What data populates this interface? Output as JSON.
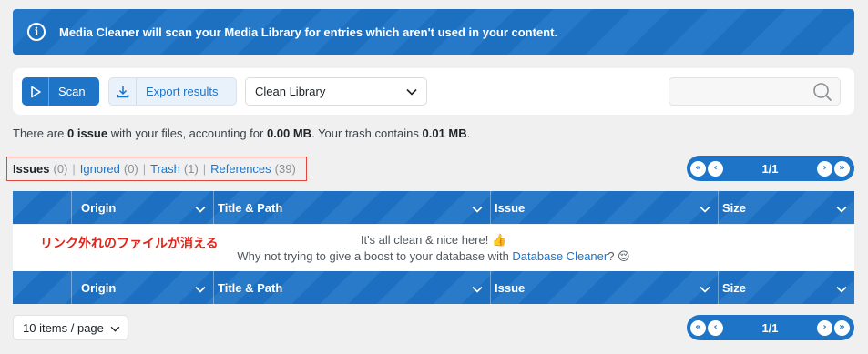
{
  "banner": {
    "icon": "info-icon",
    "text": "Media Cleaner will scan your Media Library for entries which aren't used in your content."
  },
  "toolbar": {
    "scan_label": "Scan",
    "export_label": "Export results",
    "select_value": "Clean Library",
    "search_placeholder": ""
  },
  "summary": {
    "prefix": "There are ",
    "issues": "0 issue",
    "mid": " with your files, accounting for ",
    "size": "0.00 MB",
    "mid2": ". Your trash contains ",
    "trash": "0.01 MB",
    "suffix": "."
  },
  "filters": [
    {
      "label": "Issues",
      "count": "(0)"
    },
    {
      "label": "Ignored",
      "count": "(0)"
    },
    {
      "label": "Trash",
      "count": "(1)"
    },
    {
      "label": "References",
      "count": "(39)"
    }
  ],
  "pagination": {
    "pages": "1/1"
  },
  "table": {
    "columns": [
      "Origin",
      "Title & Path",
      "Issue",
      "Size"
    ],
    "empty_line1": "It's all clean & nice here! 👍",
    "empty_line2_prefix": "Why not trying to give a boost to your database with ",
    "empty_line2_link": "Database Cleaner",
    "empty_line2_suffix": "? 😌"
  },
  "annotation": "リンク外れのファイルが消える",
  "footer": {
    "per_page": "10 items / page"
  },
  "colors": {
    "accent": "#1e74c7",
    "annotation": "#e2251b",
    "background": "#f0f0f1"
  }
}
